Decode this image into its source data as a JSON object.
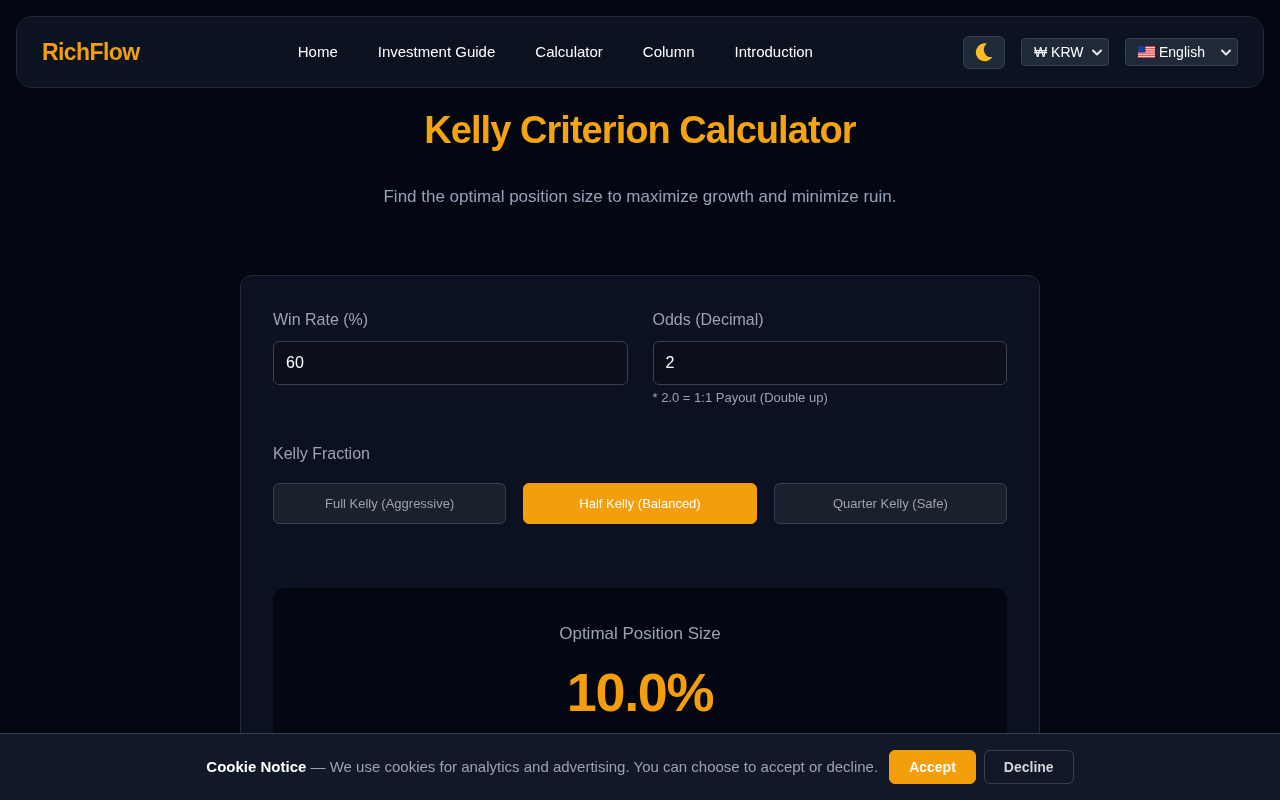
{
  "header": {
    "logo": "RichFlow",
    "nav": [
      {
        "label": "Home"
      },
      {
        "label": "Investment Guide"
      },
      {
        "label": "Calculator"
      },
      {
        "label": "Column"
      },
      {
        "label": "Introduction"
      }
    ],
    "currency": {
      "value": "₩ KRW"
    },
    "language": {
      "value": "English"
    }
  },
  "page": {
    "title": "Kelly Criterion Calculator",
    "subtitle": "Find the optimal position size to maximize growth and minimize ruin."
  },
  "calculator": {
    "fields": [
      {
        "label": "Win Rate (%)",
        "value": "60"
      },
      {
        "label": "Odds (Decimal)",
        "value": "2",
        "hint": "* 2.0 = 1:1 Payout (Double up)"
      }
    ],
    "fraction": {
      "label": "Kelly Fraction",
      "options": [
        {
          "label": "Full Kelly (Aggressive)",
          "selected": false
        },
        {
          "label": "Half Kelly (Balanced)",
          "selected": true
        },
        {
          "label": "Quarter Kelly (Safe)",
          "selected": false
        }
      ]
    },
    "result": {
      "label": "Optimal Position Size",
      "value": "10.0%"
    }
  },
  "cookie_notice": {
    "text": "**Cookie Notice** — We use cookies for analytics and advertising. You can choose to accept or decline.",
    "buttons": [
      {
        "label": "Accept",
        "kind": "primary"
      },
      {
        "label": "Decline",
        "kind": "secondary"
      }
    ]
  }
}
